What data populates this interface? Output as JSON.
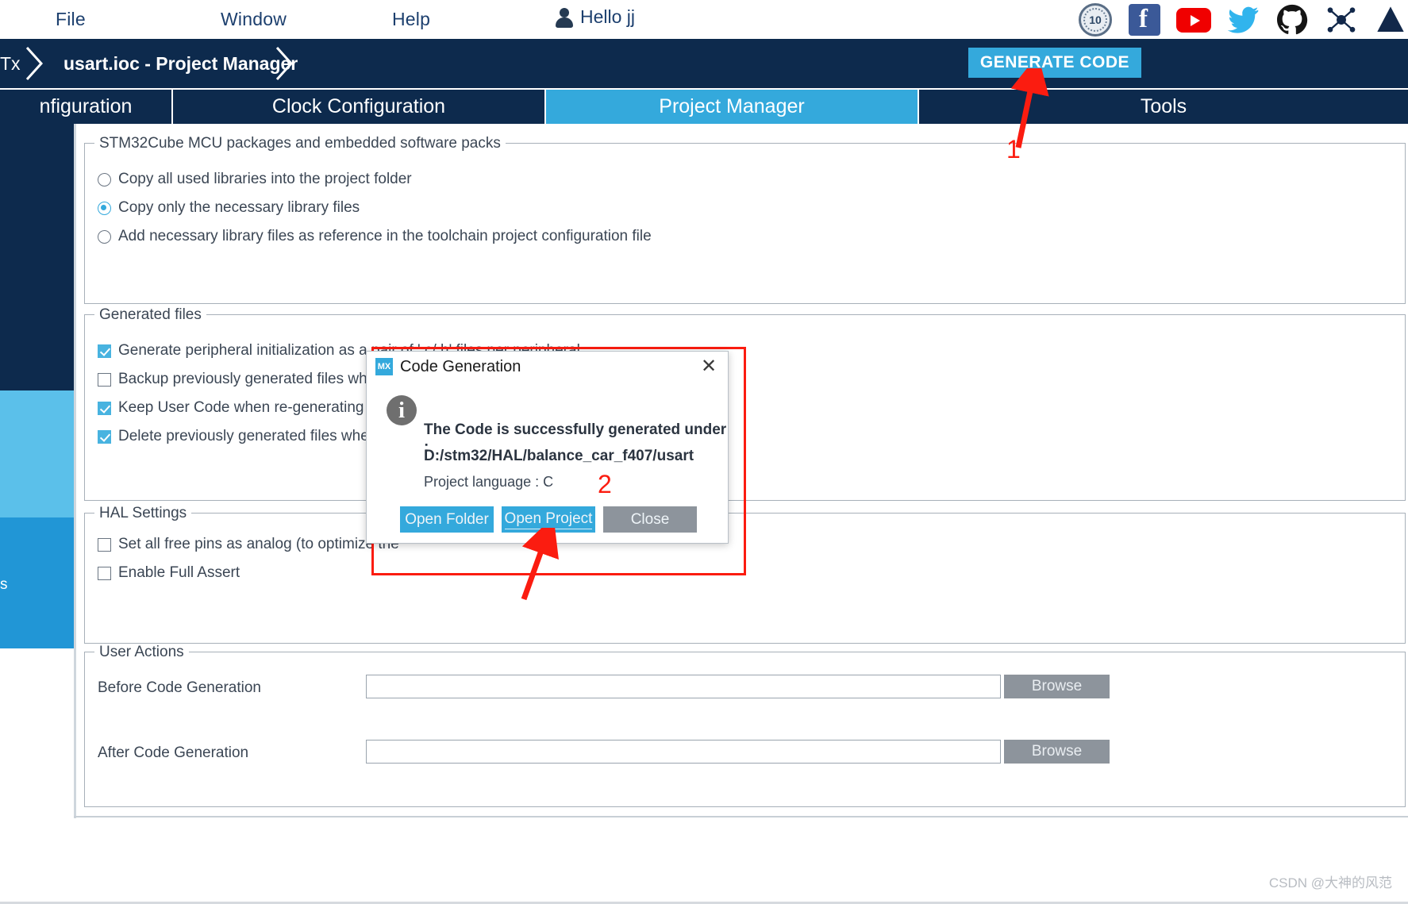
{
  "menubar": {
    "file": "File",
    "window": "Window",
    "help": "Help",
    "hello": "Hello jj",
    "icons": [
      {
        "name": "anniversary-10-years-badge-icon",
        "label": "10"
      },
      {
        "name": "facebook-icon",
        "label": "f"
      },
      {
        "name": "youtube-icon",
        "label": ""
      },
      {
        "name": "twitter-icon",
        "label": ""
      },
      {
        "name": "github-icon",
        "label": ""
      },
      {
        "name": "network-share-icon",
        "label": ""
      },
      {
        "name": "st-logo-icon",
        "label": ""
      }
    ]
  },
  "breadcrumb": {
    "first": "Tx",
    "second": "usart.ioc - Project Manager",
    "generate_code": "GENERATE CODE"
  },
  "tabs": [
    {
      "label": "nfiguration",
      "active": false
    },
    {
      "label": "Clock Configuration",
      "active": false
    },
    {
      "label": "Project Manager",
      "active": true
    },
    {
      "label": "Tools",
      "active": false
    }
  ],
  "sidebar": {
    "partial_label": "s"
  },
  "packages": {
    "title": "STM32Cube MCU packages and embedded software packs",
    "options": [
      {
        "label": "Copy all used libraries into the project folder",
        "selected": false
      },
      {
        "label": "Copy only the necessary library files",
        "selected": true
      },
      {
        "label": "Add necessary library files as reference in the toolchain project configuration file",
        "selected": false
      }
    ]
  },
  "generated_files": {
    "title": "Generated files",
    "options": [
      {
        "label": "Generate peripheral initialization as a pair of '.c/.h' files per peripheral",
        "checked": true
      },
      {
        "label": "Backup previously generated files when re-g",
        "checked": false
      },
      {
        "label": "Keep User Code when re-generating",
        "checked": true
      },
      {
        "label": "Delete previously generated files when not r",
        "checked": true
      }
    ]
  },
  "hal_settings": {
    "title": "HAL Settings",
    "options": [
      {
        "label": "Set all free pins as analog (to optimize the",
        "checked": false
      },
      {
        "label": "Enable Full Assert",
        "checked": false
      }
    ]
  },
  "user_actions": {
    "title": "User Actions",
    "rows": [
      {
        "label": "Before Code Generation",
        "value": "",
        "button": "Browse"
      },
      {
        "label": "After Code Generation",
        "value": "",
        "button": "Browse"
      }
    ]
  },
  "dialog": {
    "icon_label": "MX",
    "title": "Code Generation",
    "close_glyph": "✕",
    "info_glyph": "i",
    "line1": "The Code is successfully generated under :",
    "line2": "D:/stm32/HAL/balance_car_f407/usart",
    "line3": "Project language : C",
    "buttons": [
      {
        "label": "Open Folder",
        "style": "primary"
      },
      {
        "label": "Open Project",
        "style": "primary-focused"
      },
      {
        "label": "Close",
        "style": "secondary"
      }
    ]
  },
  "annotations": [
    {
      "number": "1",
      "target": "generate-code-button"
    },
    {
      "number": "2",
      "target": "open-project-button"
    }
  ],
  "watermark": "CSDN @大神的风范",
  "colors": {
    "navy": "#0d2a4d",
    "accent_blue": "#34a9dc",
    "light_blue": "#5bc0ea",
    "annotation_red": "#fb1c10",
    "grey_button": "#8d949c"
  }
}
